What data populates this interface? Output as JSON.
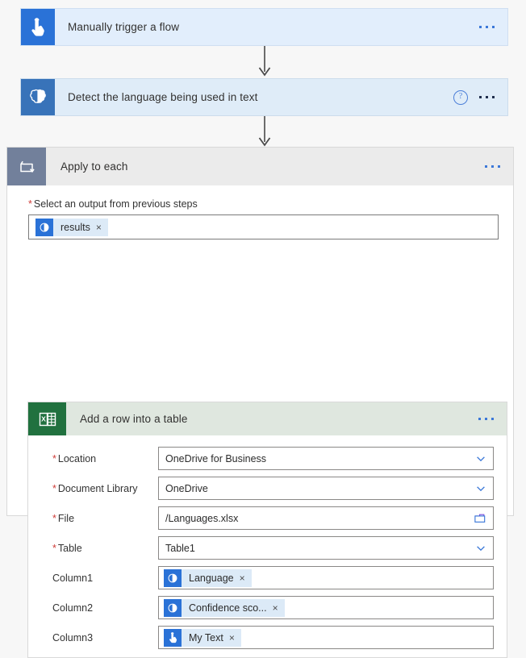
{
  "flow": {
    "trigger_card": {
      "title": "Manually trigger a flow",
      "icon": "hand-tap-icon",
      "accent": "#2a72d7",
      "background": "#e2eefc",
      "menu_label": "More commands"
    },
    "detect_card": {
      "title": "Detect the language being used in text",
      "icon": "brain-icon",
      "accent": "#3873b9",
      "background": "#dfecf8",
      "help_label": "?",
      "menu_label": "More commands"
    },
    "loop": {
      "title": "Apply to each",
      "icon": "loop-icon",
      "accent": "#72809b",
      "background": "#ebebeb",
      "menu_label": "More commands",
      "output_field": {
        "required_marker": "*",
        "label": "Select an output from previous steps",
        "token": {
          "text": "results",
          "icon": "brain-icon",
          "close": "×"
        }
      }
    },
    "excel_action": {
      "title": "Add a row into a table",
      "icon": "excel-icon",
      "accent": "#21713f",
      "background": "#dfe7df",
      "menu_label": "More commands",
      "fields": [
        {
          "label": "Location",
          "required": true,
          "required_marker": "*",
          "value": "OneDrive for Business",
          "control": "dropdown"
        },
        {
          "label": "Document Library",
          "required": true,
          "required_marker": "*",
          "value": "OneDrive",
          "control": "dropdown"
        },
        {
          "label": "File",
          "required": true,
          "required_marker": "*",
          "value": "/Languages.xlsx",
          "control": "file-picker"
        },
        {
          "label": "Table",
          "required": true,
          "required_marker": "*",
          "value": "Table1",
          "control": "dropdown"
        },
        {
          "label": "Column1",
          "required": false,
          "required_marker": "",
          "control": "token",
          "token": {
            "text": "Language",
            "icon": "brain-icon",
            "close": "×"
          }
        },
        {
          "label": "Column2",
          "required": false,
          "required_marker": "",
          "control": "token",
          "token": {
            "text": "Confidence sco...",
            "icon": "brain-icon",
            "close": "×"
          }
        },
        {
          "label": "Column3",
          "required": false,
          "required_marker": "",
          "control": "token",
          "token": {
            "text": "My Text",
            "icon": "hand-tap-icon",
            "close": "×"
          }
        }
      ]
    }
  },
  "colors": {
    "canvas": "#f7f7f7",
    "accent_blue": "#2a72d7",
    "excel_green": "#21713f",
    "loop_gray": "#72809b",
    "required_red": "#cf3c38",
    "ellipsis_blue": "#3b78d8"
  }
}
